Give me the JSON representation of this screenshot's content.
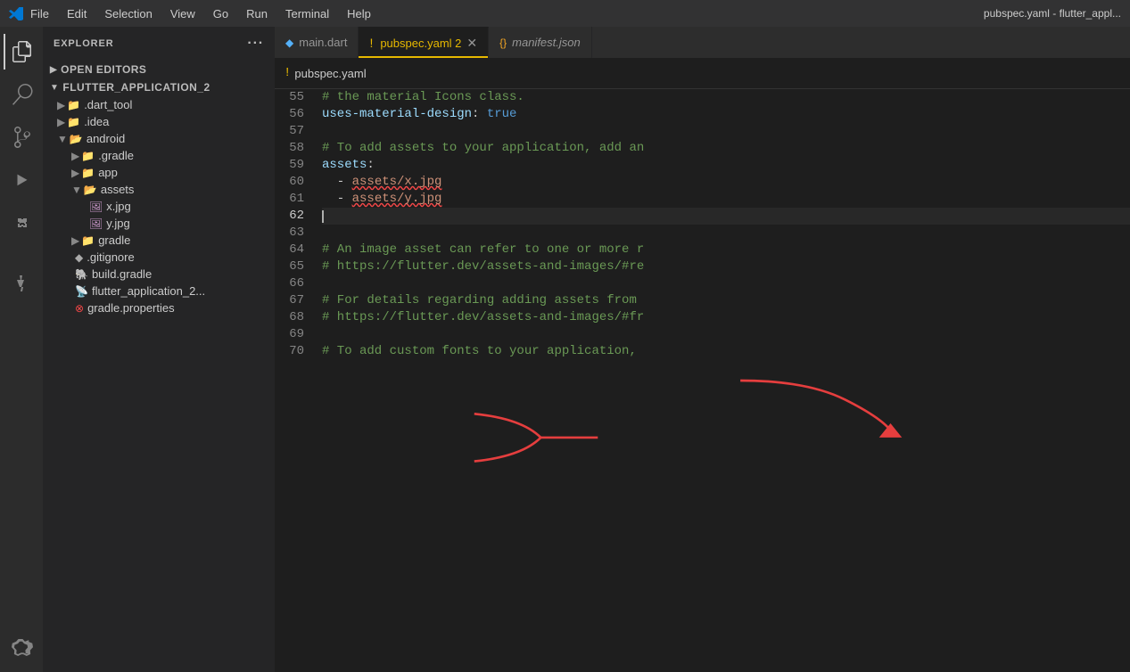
{
  "titlebar": {
    "menu_items": [
      "File",
      "Edit",
      "Selection",
      "View",
      "Go",
      "Run",
      "Terminal",
      "Help"
    ],
    "title_right": "pubspec.yaml - flutter_appl..."
  },
  "activity_bar": {
    "icons": [
      {
        "name": "explorer-icon",
        "symbol": "⎘",
        "active": true
      },
      {
        "name": "search-icon",
        "symbol": "🔍",
        "active": false
      },
      {
        "name": "source-control-icon",
        "symbol": "⎇",
        "active": false
      },
      {
        "name": "run-icon",
        "symbol": "▷",
        "active": false
      },
      {
        "name": "extensions-icon",
        "symbol": "⊞",
        "active": false
      },
      {
        "name": "test-icon",
        "symbol": "⚗",
        "active": false
      },
      {
        "name": "remote-icon",
        "symbol": "≪",
        "active": false
      }
    ]
  },
  "sidebar": {
    "header": "Explorer",
    "header_dots": "···",
    "open_editors_label": "Open Editors",
    "project_name": "FLUTTER_APPLICATION_2",
    "tree": [
      {
        "id": "dart_tool",
        "label": ".dart_tool",
        "indent": 16,
        "type": "folder",
        "collapsed": true
      },
      {
        "id": "idea",
        "label": ".idea",
        "indent": 16,
        "type": "folder",
        "collapsed": true
      },
      {
        "id": "android",
        "label": "android",
        "indent": 16,
        "type": "folder",
        "collapsed": false
      },
      {
        "id": "gradle_folder",
        "label": ".gradle",
        "indent": 32,
        "type": "folder",
        "collapsed": true
      },
      {
        "id": "app",
        "label": "app",
        "indent": 32,
        "type": "folder",
        "collapsed": true
      },
      {
        "id": "assets",
        "label": "assets",
        "indent": 32,
        "type": "folder",
        "collapsed": false
      },
      {
        "id": "xjpg",
        "label": "x.jpg",
        "indent": 52,
        "type": "image"
      },
      {
        "id": "yjpg",
        "label": "y.jpg",
        "indent": 52,
        "type": "image"
      },
      {
        "id": "gradle",
        "label": "gradle",
        "indent": 32,
        "type": "folder",
        "collapsed": true
      },
      {
        "id": "gitignore",
        "label": ".gitignore",
        "indent": 32,
        "type": "git"
      },
      {
        "id": "build_gradle",
        "label": "build.gradle",
        "indent": 32,
        "type": "gradle"
      },
      {
        "id": "flutter_app",
        "label": "flutter_application_2...",
        "indent": 32,
        "type": "rss"
      },
      {
        "id": "gradle_props",
        "label": "gradle.properties",
        "indent": 32,
        "type": "error"
      }
    ]
  },
  "tabs": [
    {
      "id": "main_dart",
      "label": "main.dart",
      "type": "dart",
      "active": false,
      "modified": false
    },
    {
      "id": "pubspec_yaml",
      "label": "pubspec.yaml 2",
      "type": "yaml",
      "active": true,
      "modified": true
    },
    {
      "id": "manifest_json",
      "label": "manifest.json",
      "type": "json",
      "active": false,
      "modified": false
    }
  ],
  "breadcrumb": {
    "items": [
      "pubspec.yaml"
    ]
  },
  "code": {
    "lines": [
      {
        "num": 55,
        "content": "comment",
        "text": "# the material Icons class."
      },
      {
        "num": 56,
        "content": "keyval",
        "key": "uses-material-design",
        "value": "true",
        "value_type": "bool"
      },
      {
        "num": 57,
        "content": "empty"
      },
      {
        "num": 58,
        "content": "comment",
        "text": "# To add assets to your application, add an"
      },
      {
        "num": 59,
        "content": "keyonly",
        "key": "assets"
      },
      {
        "num": 60,
        "content": "listasset",
        "asset": "assets/x.jpg"
      },
      {
        "num": 61,
        "content": "listasset",
        "asset": "assets/y.jpg"
      },
      {
        "num": 62,
        "content": "cursor"
      },
      {
        "num": 63,
        "content": "empty"
      },
      {
        "num": 64,
        "content": "comment",
        "text": "# An image asset can refer to one or more r"
      },
      {
        "num": 65,
        "content": "comment",
        "text": "# https://flutter.dev/assets-and-images/#re"
      },
      {
        "num": 66,
        "content": "empty"
      },
      {
        "num": 67,
        "content": "comment",
        "text": "# For details regarding adding assets from"
      },
      {
        "num": 68,
        "content": "comment",
        "text": "# https://flutter.dev/assets-and-images/#fr"
      },
      {
        "num": 69,
        "content": "empty"
      },
      {
        "num": 70,
        "content": "comment",
        "text": "# To add custom fonts to your application,"
      }
    ]
  },
  "annotations": {
    "red_arrow_1": "arrow from assets folder to assets: in yaml",
    "red_arrow_2": "arrow from x.jpg/y.jpg entries to assets/x.jpg assets/y.jpg lines"
  }
}
